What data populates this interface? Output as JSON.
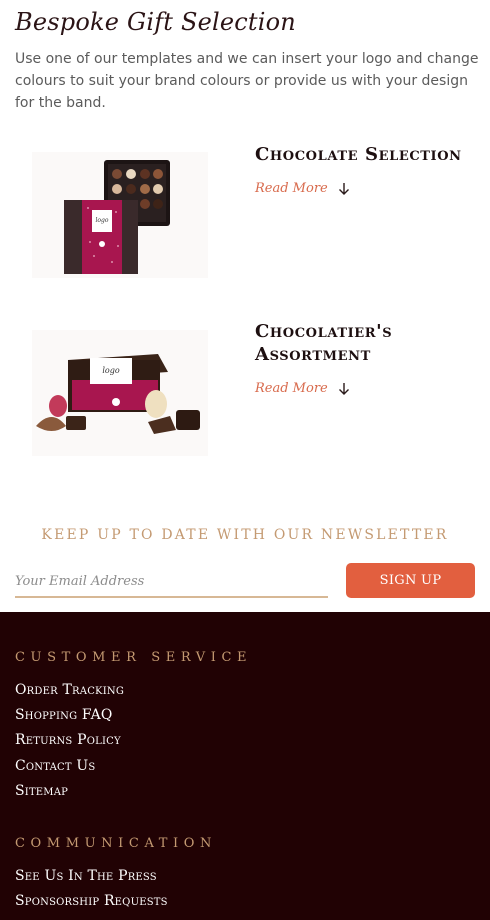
{
  "page": {
    "title": "Bespoke Gift Selection",
    "intro": "Use one of our templates and we can insert your logo and change colours to suit your brand colours or provide us with your design for the band."
  },
  "products": [
    {
      "title": "Chocolate Selection",
      "read_more": "Read More",
      "image_icon": "chocolate-box-image",
      "logo_text": "logo"
    },
    {
      "title": "Chocolatier's Assortment",
      "read_more": "Read More",
      "image_icon": "chocolate-assortment-image",
      "logo_text": "logo"
    }
  ],
  "newsletter": {
    "heading": "Keep up to date with our newsletter",
    "placeholder": "Your Email Address",
    "button": "Sign Up"
  },
  "footer": {
    "customer_service": {
      "heading": "Customer Service",
      "links": [
        "Order Tracking",
        "Shopping FAQ",
        "Returns Policy",
        "Contact Us",
        "Sitemap"
      ]
    },
    "communication": {
      "heading": "Communication",
      "links": [
        "See Us In The Press",
        "Sponsorship Requests"
      ]
    }
  },
  "colors": {
    "accent": "#e25f3f",
    "link": "#d86a4c",
    "gold": "#c49a72",
    "footer_bg": "#210204",
    "band_magenta": "#a8164f"
  }
}
